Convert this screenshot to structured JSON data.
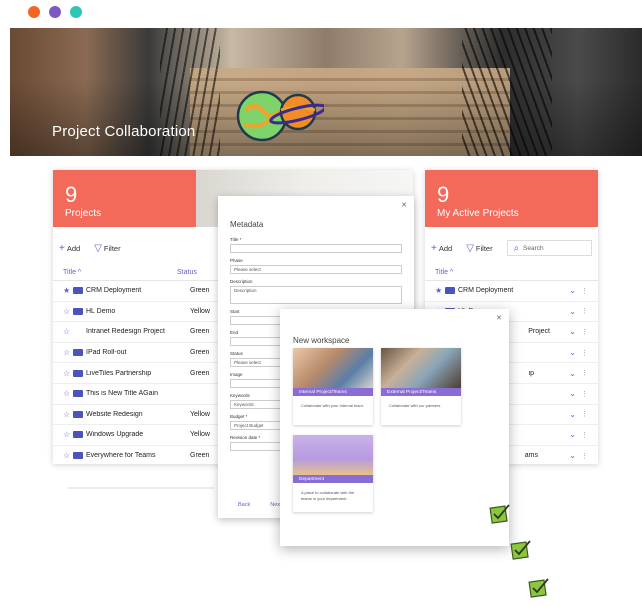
{
  "colors": {
    "accent": "#f36a5a",
    "brand": "#6b5bd0",
    "teams": "#4b53bc",
    "dot1": "#f26522",
    "dot2": "#7e57c2",
    "dot3": "#2ec4b6"
  },
  "hero": {
    "title": "Project Collaboration"
  },
  "projects_panel": {
    "count": "9",
    "label": "Projects",
    "add_label": "Add",
    "filter_label": "Filter",
    "col_title": "Title ^",
    "col_status": "Status",
    "rows": [
      {
        "star": "★",
        "name": "CRM Deployment",
        "status": "Green"
      },
      {
        "star": "☆",
        "name": "HL Demo",
        "status": "Yellow"
      },
      {
        "star": "☆",
        "name": "Intranet Redesign Project",
        "status": "Green"
      },
      {
        "star": "☆",
        "name": "IPad Roll-out",
        "status": "Green"
      },
      {
        "star": "☆",
        "name": "LiveTiles Partnership",
        "status": "Green"
      },
      {
        "star": "☆",
        "name": "This is New Title AGain",
        "status": ""
      },
      {
        "star": "☆",
        "name": "Website Redesign",
        "status": "Yellow"
      },
      {
        "star": "☆",
        "name": "Windows Upgrade",
        "status": "Yellow"
      },
      {
        "star": "☆",
        "name": "Everywhere for Teams",
        "status": "Green"
      }
    ]
  },
  "active_panel": {
    "count": "9",
    "label": "My Active Projects",
    "add_label": "Add",
    "filter_label": "Filter",
    "search_placeholder": "Search",
    "col_title": "Title ^",
    "rows": [
      {
        "star": "★",
        "name": "CRM Deployment"
      },
      {
        "star": "☆",
        "name": "HL Demo"
      },
      {
        "star": "☆",
        "name": "Project"
      },
      {
        "star": "☆",
        "name": ""
      },
      {
        "star": "☆",
        "name": "ip"
      },
      {
        "star": "☆",
        "name": ""
      },
      {
        "star": "☆",
        "name": ""
      },
      {
        "star": "☆",
        "name": ""
      },
      {
        "star": "☆",
        "name": "ams"
      }
    ]
  },
  "metadata": {
    "title": "Metadata",
    "fields": [
      {
        "label": "Title *",
        "value": ""
      },
      {
        "label": "Phase",
        "value": "Please select"
      },
      {
        "label": "Description",
        "value": "Description"
      },
      {
        "label": "Start",
        "value": ""
      },
      {
        "label": "End",
        "value": ""
      },
      {
        "label": "Status",
        "value": "Please select"
      },
      {
        "label": "Image",
        "value": ""
      },
      {
        "label": "Keywords",
        "value": "Keywords"
      },
      {
        "label": "Budget *",
        "value": "Project Budget"
      },
      {
        "label": "Revision date *",
        "value": ""
      }
    ],
    "back_label": "Back",
    "next_label": "Nex"
  },
  "workspace": {
    "title": "New workspace",
    "cards": [
      {
        "label": "Internal Project/Teams",
        "desc": "Collaborate with your internal team."
      },
      {
        "label": "External Project/Teams",
        "desc": "Collaborate with our partners"
      },
      {
        "label": "Department",
        "desc": "A place to collaborate with the teams in your department."
      }
    ]
  }
}
